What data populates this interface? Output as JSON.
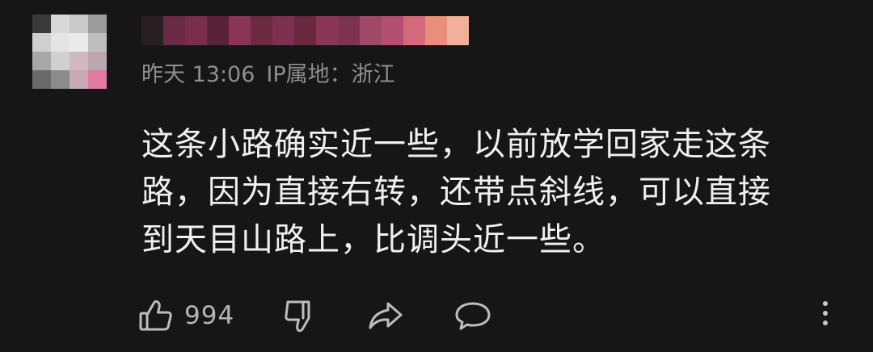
{
  "comment": {
    "avatar_blocks": [
      "#3a3a3a",
      "#d8d8d8",
      "#c9c9c9",
      "#9c9c9c",
      "#cfcfcf",
      "#e4e4e4",
      "#eaeaea",
      "#bdbdbd",
      "#a8a8a8",
      "#d2cfcf",
      "#cfb8c0",
      "#bca7af",
      "#6a6a6a",
      "#8b8b8b",
      "#c9a9b5",
      "#e07aa3"
    ],
    "username_blocks": [
      "#2a1e22",
      "#6b2a45",
      "#7a2d4c",
      "#5a2236",
      "#8a3556",
      "#6c2a43",
      "#7c3150",
      "#6a2841",
      "#8a3656",
      "#7d3250",
      "#a04868",
      "#b24f73",
      "#d26a7b",
      "#e88e7a",
      "#f2b09c"
    ],
    "timestamp": "昨天 13:06",
    "ip_location": "IP属地：浙江",
    "body_lines": [
      "这条小路确实近一些，以前放学回家走这条",
      "路，因为直接右转，还带点斜线，可以直接",
      "到天目山路上，比调头近一些。"
    ],
    "actions": {
      "like_icon": "thumbs-up-icon",
      "like_count": "994",
      "dislike_icon": "thumbs-down-icon",
      "share_icon": "share-icon",
      "reply_icon": "comment-bubble-icon",
      "more_icon": "more-vertical-icon"
    }
  }
}
